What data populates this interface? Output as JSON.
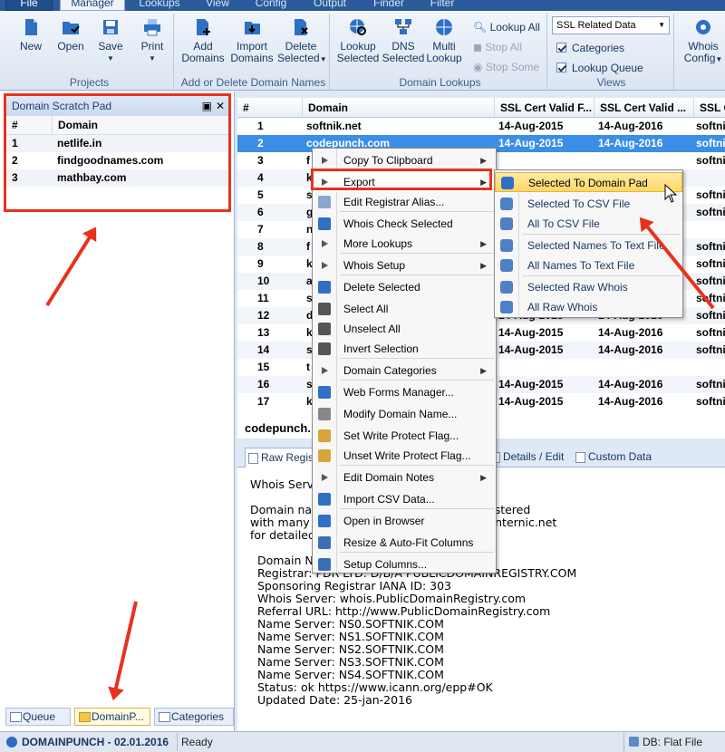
{
  "tabs": [
    "File",
    "Manager",
    "Lookups",
    "View",
    "Config",
    "Output",
    "Finder",
    "Filter"
  ],
  "ribbon": {
    "projects": {
      "label": "Projects",
      "buttons": [
        "New",
        "Open",
        "Save",
        "Print"
      ]
    },
    "add_delete": {
      "label": "Add or Delete Domain Names",
      "add": [
        "Add",
        "Domains"
      ],
      "import": [
        "Import",
        "Domains"
      ],
      "delete": [
        "Delete",
        "Selected"
      ]
    },
    "lookups": {
      "label": "Domain Lookups",
      "buttons": [
        [
          "Lookup",
          "Selected"
        ],
        [
          "DNS",
          "Selected"
        ],
        [
          "Multi",
          "Lookup"
        ]
      ],
      "small": [
        "Lookup All",
        "Stop All",
        "Stop Some"
      ]
    },
    "views": {
      "label": "Views",
      "select": "SSL Related Data",
      "checks": [
        "Categories",
        "Lookup Queue"
      ]
    },
    "whois_config": [
      "Whois",
      "Config"
    ]
  },
  "scratch_pad": {
    "title": "Domain Scratch Pad",
    "pin": "📌",
    "close": "✕",
    "headers": [
      "#",
      "Domain"
    ],
    "rows": [
      {
        "n": "1",
        "domain": "netlife.in"
      },
      {
        "n": "2",
        "domain": "findgoodnames.com"
      },
      {
        "n": "3",
        "domain": "mathbay.com"
      }
    ]
  },
  "bottom_tabs": [
    "Queue",
    "DomainP...",
    "Categories"
  ],
  "grid": {
    "headers": [
      "#",
      "Domain",
      "SSL Cert Valid F...",
      "SSL Cert Valid ...",
      "SSL C"
    ],
    "rows": [
      {
        "n": "1",
        "domain": "softnik.net",
        "from": "14-Aug-2015",
        "to": "14-Aug-2016",
        "issuer": "softni"
      },
      {
        "n": "2",
        "domain": "codepunch.com",
        "from": "14-Aug-2015",
        "to": "14-Aug-2016",
        "issuer": "softni"
      },
      {
        "n": "3",
        "domain": "f",
        "from": "",
        "to": "",
        "issuer": "softni"
      },
      {
        "n": "4",
        "domain": "k",
        "from": "",
        "to": "",
        "issuer": ""
      },
      {
        "n": "5",
        "domain": "s",
        "from": "",
        "to": "",
        "issuer": "softni"
      },
      {
        "n": "6",
        "domain": "g",
        "from": "",
        "to": "",
        "issuer": "softni"
      },
      {
        "n": "7",
        "domain": "n",
        "from": "",
        "to": "",
        "issuer": ""
      },
      {
        "n": "8",
        "domain": "f",
        "from": "",
        "to": "",
        "issuer": "softni"
      },
      {
        "n": "9",
        "domain": "k",
        "from": "",
        "to": "",
        "issuer": "softni"
      },
      {
        "n": "10",
        "domain": "a",
        "from": "",
        "to": "",
        "issuer": "softni"
      },
      {
        "n": "11",
        "domain": "s",
        "from": "",
        "to": "",
        "issuer": "softni"
      },
      {
        "n": "12",
        "domain": "d",
        "from": "14-Aug-2015",
        "to": "14-Aug-2016",
        "issuer": "softni"
      },
      {
        "n": "13",
        "domain": "k",
        "from": "14-Aug-2015",
        "to": "14-Aug-2016",
        "issuer": "softni"
      },
      {
        "n": "14",
        "domain": "s",
        "from": "14-Aug-2015",
        "to": "14-Aug-2016",
        "issuer": "softni"
      },
      {
        "n": "15",
        "domain": "t",
        "from": "",
        "to": "",
        "issuer": ""
      },
      {
        "n": "16",
        "domain": "s",
        "from": "14-Aug-2015",
        "to": "14-Aug-2016",
        "issuer": "softni"
      },
      {
        "n": "17",
        "domain": "k",
        "from": "14-Aug-2015",
        "to": "14-Aug-2016",
        "issuer": "softni"
      }
    ]
  },
  "detail": {
    "title": "codepunch.",
    "tabs": [
      "Raw Regis",
      "Details / Edit",
      "Custom Data"
    ],
    "whois_text": "Whois Serv\n\nDomain na                       s can now be registered\nwith many                       Go to http://www.internic.net\nfor detailed\n\n  Domain N\n  Registrar: PDR LTD. D/B/A PUBLICDOMAINREGISTRY.COM\n  Sponsoring Registrar IANA ID: 303\n  Whois Server: whois.PublicDomainRegistry.com\n  Referral URL: http://www.PublicDomainRegistry.com\n  Name Server: NS0.SOFTNIK.COM\n  Name Server: NS1.SOFTNIK.COM\n  Name Server: NS2.SOFTNIK.COM\n  Name Server: NS3.SOFTNIK.COM\n  Name Server: NS4.SOFTNIK.COM\n  Status: ok https://www.icann.org/epp#OK\n  Updated Date: 25-jan-2016"
  },
  "context_menu": [
    {
      "label": "Copy To Clipboard",
      "sub": true
    },
    {
      "label": "Export",
      "sub": true
    },
    {
      "label": "Edit Registrar Alias..."
    },
    {
      "label": "Whois Check Selected"
    },
    {
      "label": "More Lookups",
      "sub": true
    },
    {
      "label": "Whois Setup",
      "sub": true
    },
    {
      "label": "Delete Selected"
    },
    {
      "label": "Select All"
    },
    {
      "label": "Unselect All"
    },
    {
      "label": "Invert Selection"
    },
    {
      "label": "Domain Categories",
      "sub": true
    },
    {
      "label": "Web Forms Manager..."
    },
    {
      "label": "Modify Domain Name..."
    },
    {
      "label": "Set Write Protect Flag..."
    },
    {
      "label": "Unset Write Protect Flag..."
    },
    {
      "label": "Edit Domain Notes",
      "sub": true
    },
    {
      "label": "Import CSV Data..."
    },
    {
      "label": "Open in Browser"
    },
    {
      "label": "Resize & Auto-Fit Columns"
    },
    {
      "label": "Setup Columns..."
    }
  ],
  "export_submenu": [
    "Selected To Domain Pad",
    "Selected To CSV File",
    "All To CSV File",
    "Selected Names To Text File",
    "All Names To Text File",
    "Selected Raw Whois",
    "All Raw Whois"
  ],
  "status": {
    "app": "DOMAINPUNCH - 02.01.2016",
    "state": "Ready",
    "db": "DB: Flat File"
  },
  "colors": {
    "accent": "#2a5a9a",
    "highlight_red": "#e8321e",
    "selection": "#3a8ee6"
  }
}
